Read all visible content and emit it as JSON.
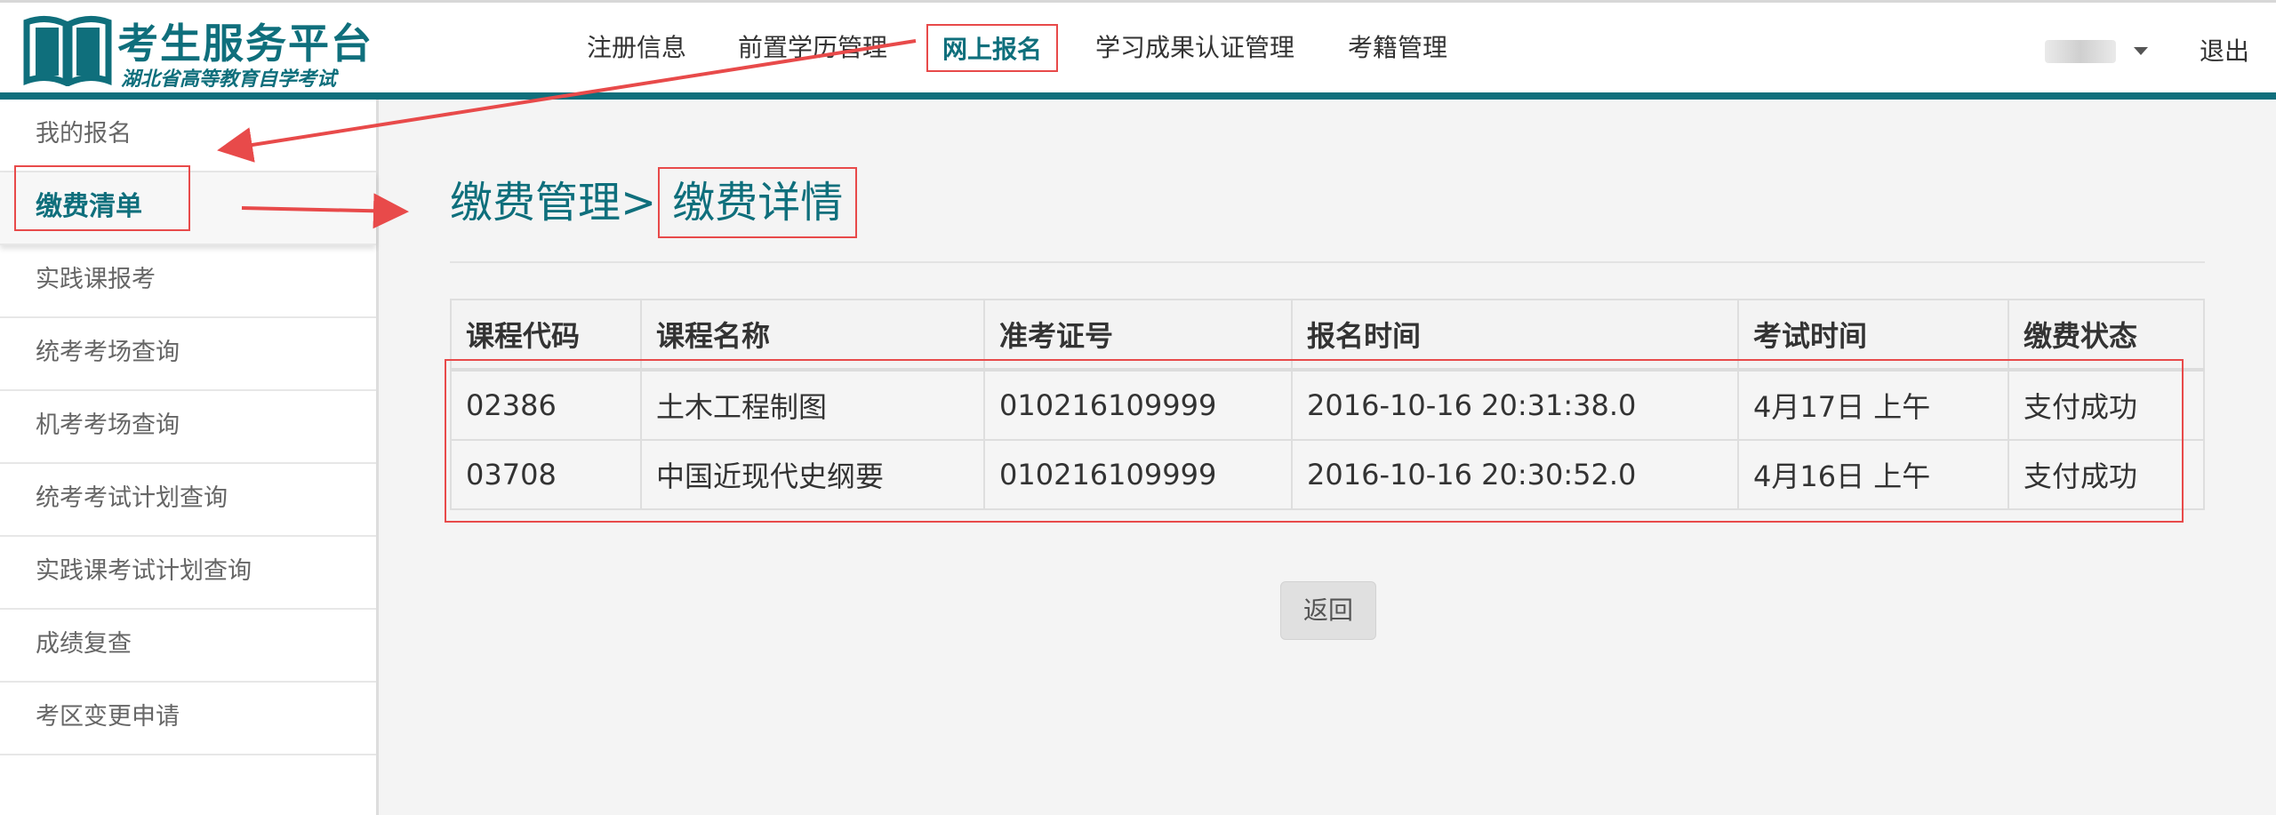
{
  "header": {
    "logo_title": "考生服务平台",
    "logo_subtitle": "湖北省高等教育自学考试",
    "nav": [
      {
        "label": "注册信息",
        "active": false
      },
      {
        "label": "前置学历管理",
        "active": false
      },
      {
        "label": "网上报名",
        "active": true
      },
      {
        "label": "学习成果认证管理",
        "active": false
      },
      {
        "label": "考籍管理",
        "active": false
      }
    ],
    "logout_label": "退出"
  },
  "sidebar": {
    "items": [
      {
        "label": "我的报名",
        "active": false
      },
      {
        "label": "缴费清单",
        "active": true
      },
      {
        "label": "实践课报考",
        "active": false
      },
      {
        "label": "统考考场查询",
        "active": false
      },
      {
        "label": "机考考场查询",
        "active": false
      },
      {
        "label": "统考考试计划查询",
        "active": false
      },
      {
        "label": "实践课考试计划查询",
        "active": false
      },
      {
        "label": "成绩复查",
        "active": false
      },
      {
        "label": "考区变更申请",
        "active": false
      }
    ]
  },
  "main": {
    "breadcrumb_parent": "缴费管理",
    "breadcrumb_sep": ">",
    "breadcrumb_current": "缴费详情",
    "table": {
      "headers": [
        "课程代码",
        "课程名称",
        "准考证号",
        "报名时间",
        "考试时间",
        "缴费状态"
      ],
      "rows": [
        [
          "02386",
          "土木工程制图",
          "010216109999",
          "2016-10-16 20:31:38.0",
          "4月17日 上午",
          "支付成功"
        ],
        [
          "03708",
          "中国近现代史纲要",
          "010216109999",
          "2016-10-16 20:30:52.0",
          "4月16日 上午",
          "支付成功"
        ]
      ]
    },
    "back_label": "返回"
  },
  "colors": {
    "accent": "#0f6f7c",
    "annotation": "#e84a4a"
  }
}
